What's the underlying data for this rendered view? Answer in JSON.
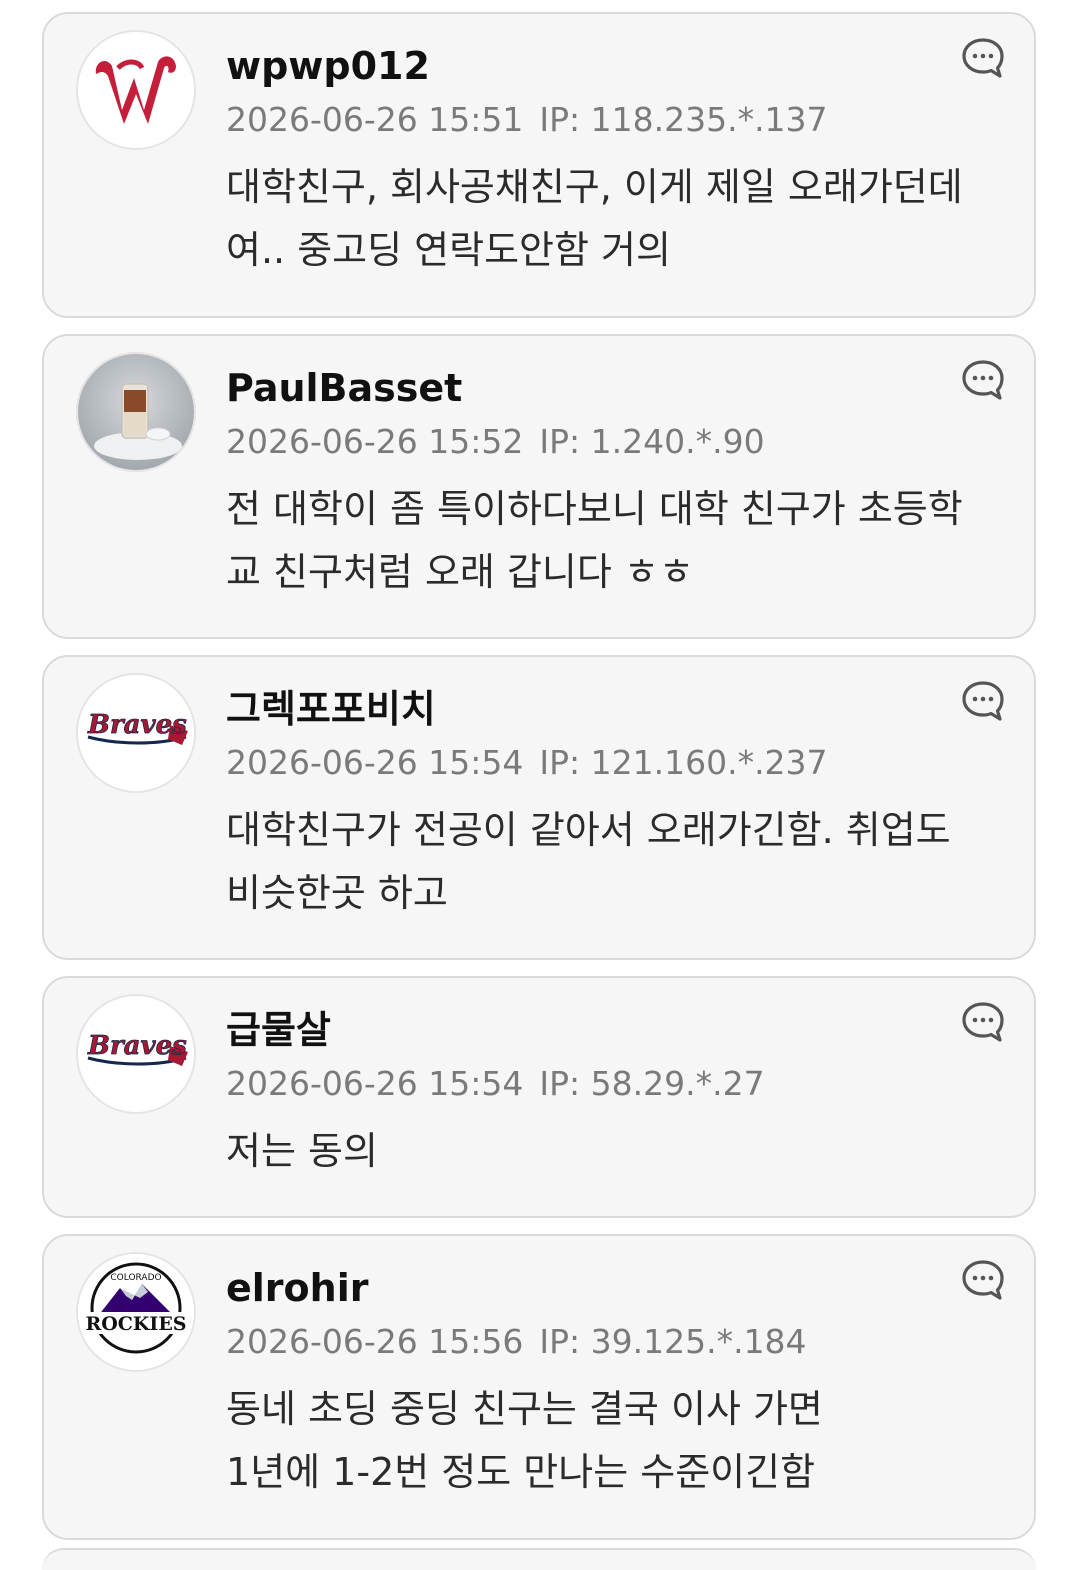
{
  "comments": [
    {
      "nickname": "wpwp012",
      "datetime": "2026-06-26 15:51",
      "ip": "IP: 118.235.*.137",
      "text": "대학친구, 회사공채친구, 이게 제일 오래가던데여.. 중고딩 연락도안함 거의",
      "avatar_icon": "nationals-logo-icon"
    },
    {
      "nickname": "PaulBasset",
      "datetime": "2026-06-26 15:52",
      "ip": "IP: 1.240.*.90",
      "text": "전 대학이 좀 특이하다보니 대학 친구가 초등학교 친구처럼 오래 갑니다 ㅎㅎ",
      "avatar_icon": "coffee-photo-icon"
    },
    {
      "nickname": "그렉포포비치",
      "datetime": "2026-06-26 15:54",
      "ip": "IP: 121.160.*.237",
      "text": "대학친구가 전공이 같아서 오래가긴함. 취업도 비슷한곳 하고",
      "avatar_icon": "braves-logo-icon"
    },
    {
      "nickname": "급물살",
      "datetime": "2026-06-26 15:54",
      "ip": "IP: 58.29.*.27",
      "text": "저는 동의",
      "avatar_icon": "braves-logo-icon"
    },
    {
      "nickname": "elrohir",
      "datetime": "2026-06-26 15:56",
      "ip": "IP: 39.125.*.184",
      "text": "동네 초딩 중딩 친구는 결국 이사 가면\n1년에 1-2번 정도 만나는 수준이긴함",
      "avatar_icon": "rockies-logo-icon"
    }
  ],
  "reply_icon": "comment-bubble-icon",
  "colors": {
    "card_bg": "#f6f6f6",
    "card_border": "#dadada",
    "meta_text": "#7a7a7a",
    "nationals_red": "#c41e3a",
    "braves_red": "#a71930",
    "braves_navy": "#13274f",
    "rockies_purple": "#33006f"
  }
}
